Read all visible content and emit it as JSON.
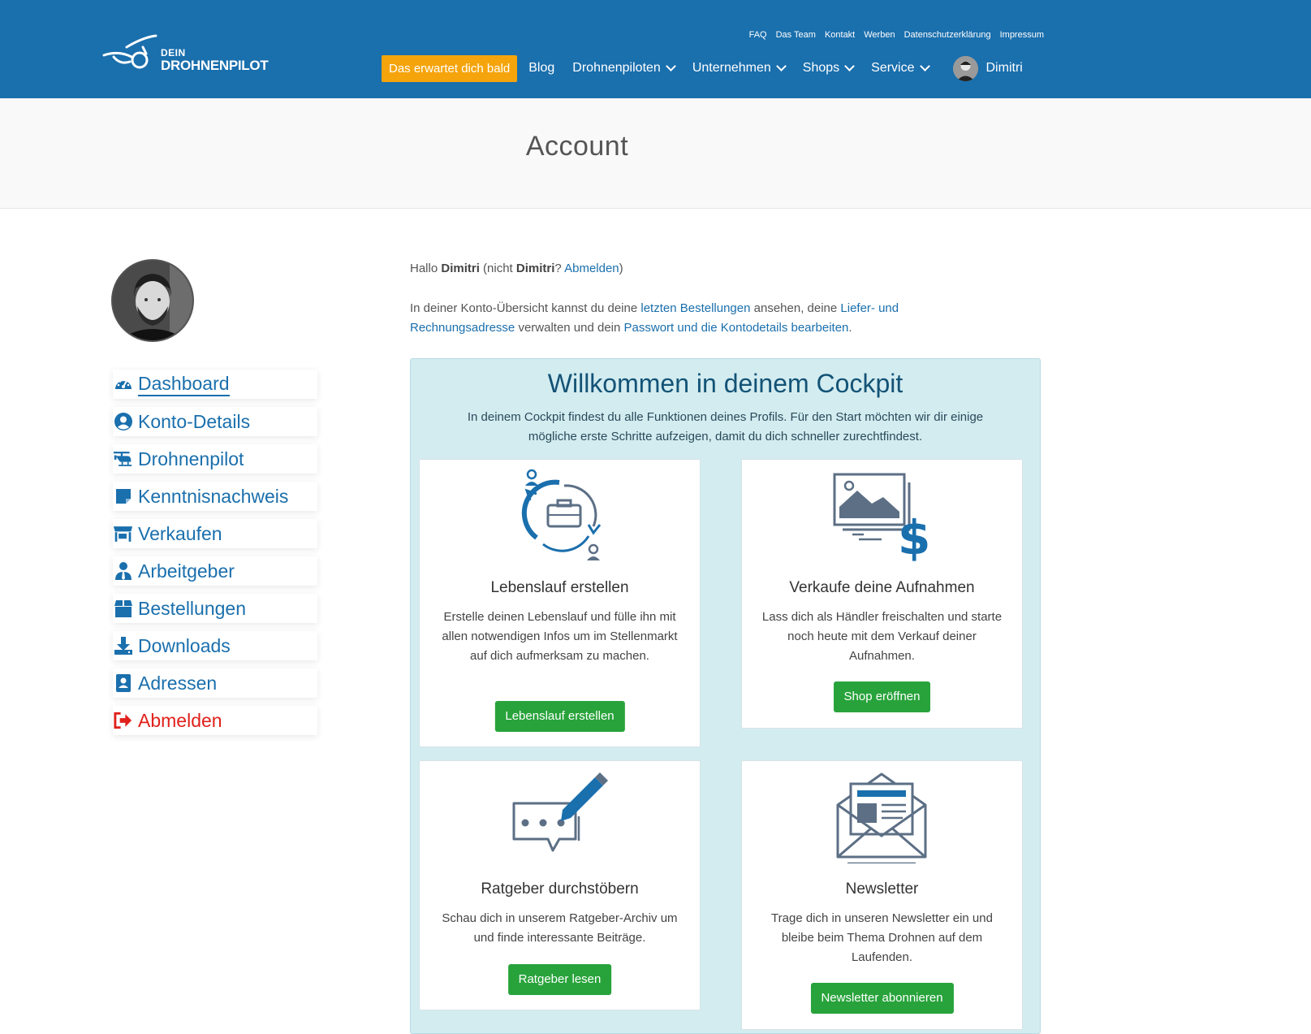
{
  "logo": {
    "small": "DEIN",
    "big": "DROHNENPILOT"
  },
  "toplinks": [
    "FAQ",
    "Das Team",
    "Kontakt",
    "Werben",
    "Datenschutzerklärung",
    "Impressum"
  ],
  "nav": {
    "cta": "Das erwartet dich bald",
    "blog": "Blog",
    "drohnenpiloten": "Drohnenpiloten",
    "unternehmen": "Unternehmen",
    "shops": "Shops",
    "service": "Service",
    "user": "Dimitri"
  },
  "page_title": "Account",
  "sidebar": {
    "items": [
      {
        "label": "Dashboard",
        "icon": "dashboard-icon"
      },
      {
        "label": "Konto-Details",
        "icon": "user-circle-icon"
      },
      {
        "label": "Drohnenpilot",
        "icon": "helicopter-icon"
      },
      {
        "label": "Kenntnisnachweis",
        "icon": "note-icon"
      },
      {
        "label": "Verkaufen",
        "icon": "store-icon"
      },
      {
        "label": "Arbeitgeber",
        "icon": "employer-icon"
      },
      {
        "label": "Bestellungen",
        "icon": "box-icon"
      },
      {
        "label": "Downloads",
        "icon": "download-icon"
      },
      {
        "label": "Adressen",
        "icon": "address-book-icon"
      },
      {
        "label": "Abmelden",
        "icon": "sign-out-icon"
      }
    ]
  },
  "greeting": {
    "hallo": "Hallo",
    "name": "Dimitri",
    "nicht": "(nicht",
    "name2": "Dimitri",
    "q": "?",
    "abmelden": "Abmelden",
    "close": ")"
  },
  "intro": {
    "t1": "In deiner Konto-Übersicht kannst du deine",
    "l1": "letzten Bestellungen",
    "t2": "ansehen, deine",
    "l2": "Liefer- und Rechnungsadresse",
    "t3": "verwalten und dein",
    "l3": "Passwort und die Kontodetails bearbeiten",
    "t4": "."
  },
  "cockpit": {
    "title": "Willkommen in deinem Cockpit",
    "desc": "In deinem Cockpit findest du alle Funktionen deines Profils. Für den Start möchten wir dir einige mögliche erste Schritte aufzeigen, damit du dich schneller zurechtfindest.",
    "cards": [
      {
        "title": "Lebenslauf erstellen",
        "text": "Erstelle deinen Lebenslauf und fülle ihn mit allen notwendigen Infos um im Stellenmarkt auf dich aufmerksam zu machen.",
        "button": "Lebenslauf erstellen"
      },
      {
        "title": "Verkaufe deine Aufnahmen",
        "text": "Lass dich als Händler freischalten und starte noch heute mit dem Verkauf deiner Aufnahmen.",
        "button": "Shop eröffnen"
      },
      {
        "title": "Ratgeber durchstöbern",
        "text": "Schau dich in unserem Ratgeber-Archiv um und finde interessante Beiträge.",
        "button": "Ratgeber lesen"
      },
      {
        "title": "Newsletter",
        "text": "Trage dich in unseren Newsletter ein und bleibe beim Thema Drohnen auf dem Laufenden.",
        "button": "Newsletter abonnieren"
      }
    ]
  },
  "colors": {
    "brand": "#1a6fad",
    "cta": "#f5a40c",
    "button": "#28a33b",
    "logout": "#e0201b",
    "panel": "#d3ecf0"
  }
}
